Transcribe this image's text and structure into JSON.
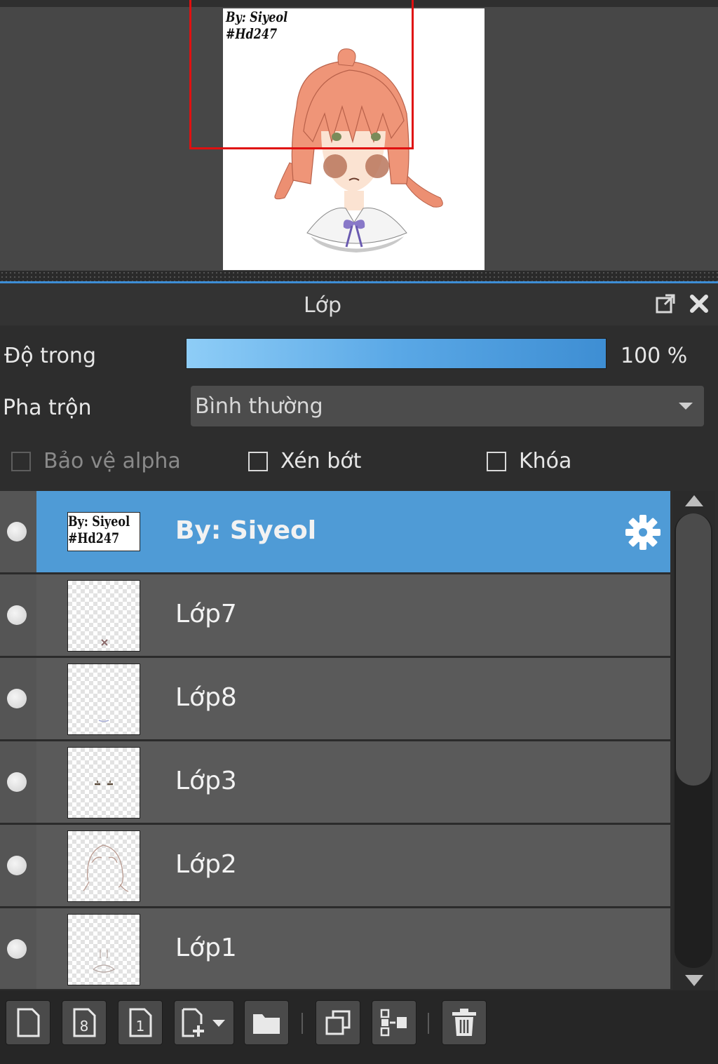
{
  "navigator": {
    "signature_line1": "By: Siyeol",
    "signature_line2": "#Hd247",
    "view_rect_color": "#e01010"
  },
  "panel": {
    "title": "Lớp",
    "popout_icon": "popout-icon",
    "close_icon": "close-icon"
  },
  "opacity": {
    "label": "Độ trong",
    "value": "100 %",
    "fill_fraction": 1.0
  },
  "blend": {
    "label": "Pha trộn",
    "value": "Bình thường"
  },
  "checks": {
    "protect_alpha": "Bảo vệ alpha",
    "clipping": "Xén bớt",
    "lock": "Khóa"
  },
  "layers": [
    {
      "name": "By: Siyeol",
      "selected": true,
      "thumb_line1": "By: Siyeol",
      "thumb_line2": "#Hd247"
    },
    {
      "name": "Lớp7",
      "selected": false
    },
    {
      "name": "Lớp8",
      "selected": false
    },
    {
      "name": "Lớp3",
      "selected": false
    },
    {
      "name": "Lớp2",
      "selected": false
    },
    {
      "name": "Lớp1",
      "selected": false
    }
  ],
  "accent_color": "#4f9bd6",
  "toolbar_icons": [
    "new-layer-icon",
    "new-8bit-layer-icon",
    "new-1bit-layer-icon",
    "add-layer-dropdown-icon",
    "new-folder-icon",
    "duplicate-layer-icon",
    "merge-down-icon",
    "delete-layer-icon"
  ]
}
